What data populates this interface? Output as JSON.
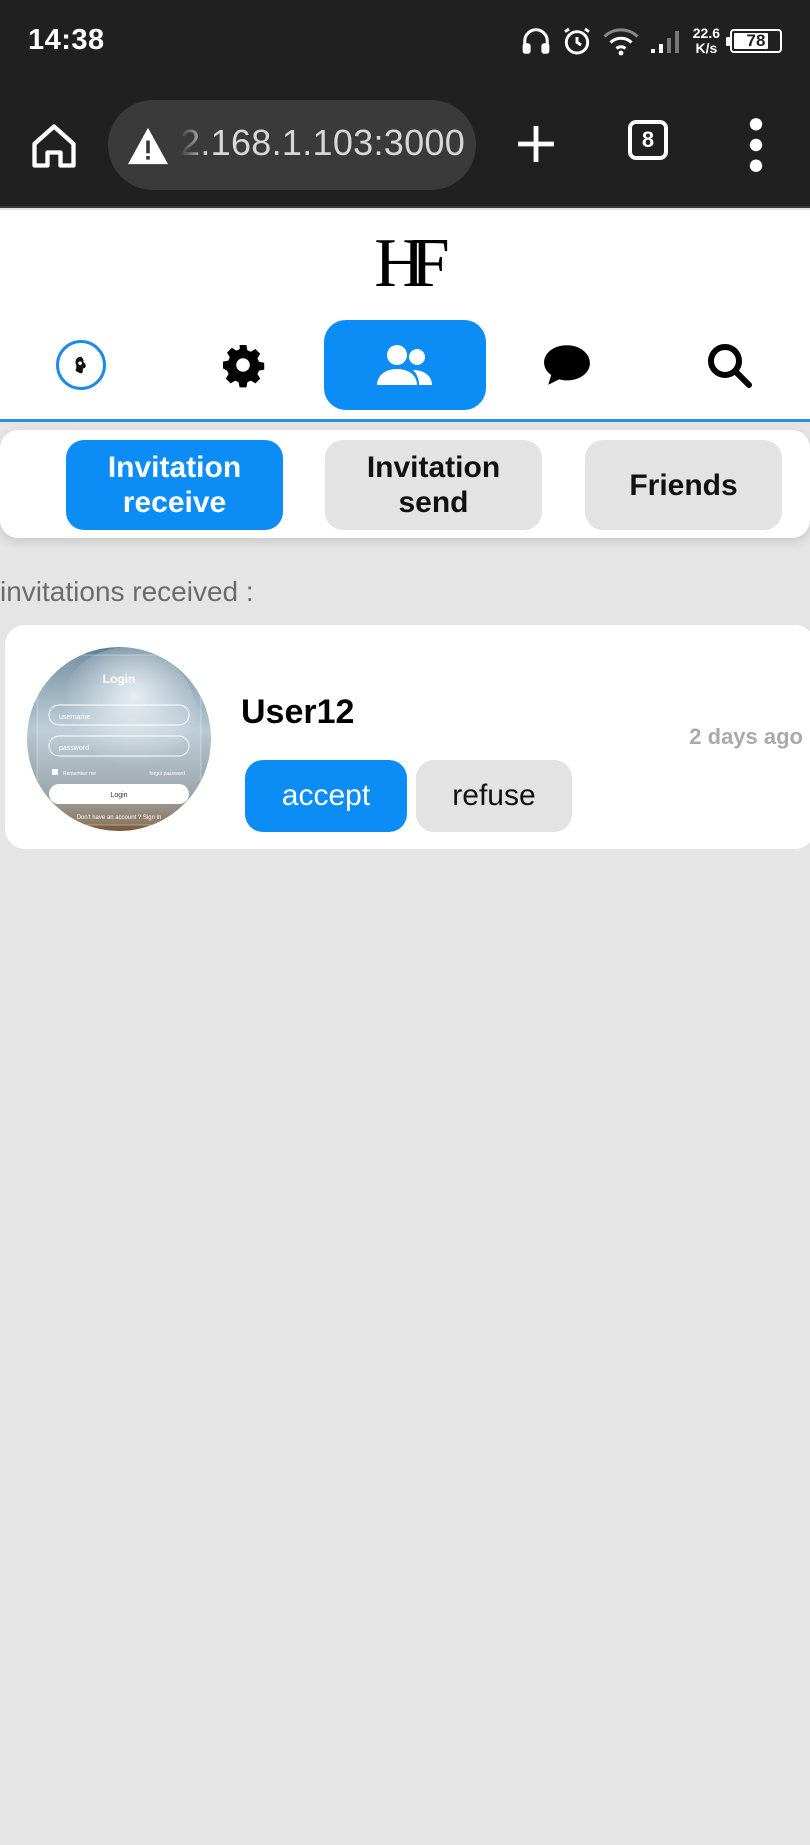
{
  "status_bar": {
    "time": "14:38",
    "net_speed_value": "22.6",
    "net_speed_unit": "K/s",
    "battery_level": "78"
  },
  "browser": {
    "url": "2.168.1.103:3000",
    "tab_count": "8"
  },
  "app": {
    "logo": "HF",
    "nav": [
      {
        "id": "profile",
        "icon": "avatar-icon",
        "active": false
      },
      {
        "id": "settings",
        "icon": "gear-icon",
        "active": false
      },
      {
        "id": "friends",
        "icon": "users-icon",
        "active": true
      },
      {
        "id": "chat",
        "icon": "chat-bubble-icon",
        "active": false
      },
      {
        "id": "search",
        "icon": "search-icon",
        "active": false
      }
    ],
    "subtabs": [
      {
        "line1": "Invitation",
        "line2": "receive",
        "active": true
      },
      {
        "line1": "Invitation",
        "line2": "send",
        "active": false
      },
      {
        "label": "Friends",
        "active": false
      }
    ]
  },
  "invitations": {
    "section_label": "invitations received :",
    "items": [
      {
        "name": "User12",
        "time": "2 days ago",
        "accept_label": "accept",
        "refuse_label": "refuse",
        "avatar_thumbnail": {
          "title": "Login",
          "username_placeholder": "username",
          "password_placeholder": "password",
          "remember_label": "Remember me",
          "forgot_label": "forgot password",
          "button_label": "Login",
          "footer_text": "Don't have an account ? Sign in"
        }
      }
    ]
  },
  "colors": {
    "accent": "#0c8cf5",
    "inactive_tab": "#e3e3e3",
    "page_bg": "#e5e5e5",
    "browser_bg": "#202020"
  }
}
